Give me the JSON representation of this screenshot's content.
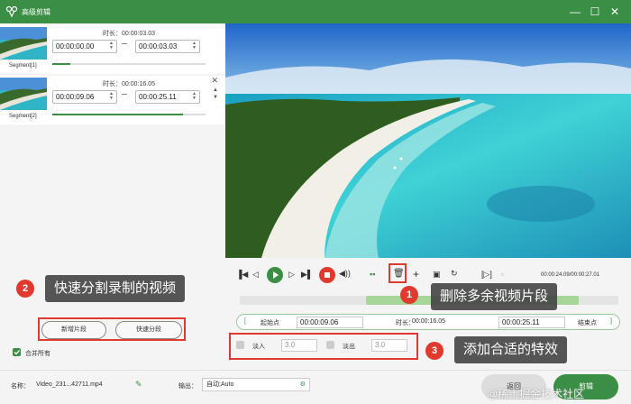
{
  "window": {
    "title": "高级剪辑"
  },
  "segments": [
    {
      "label": "Segment[1]",
      "duration": "时长：00:00:03.03",
      "start": "00:00:00.00",
      "end": "00:00:03.03",
      "progress": 0.12
    },
    {
      "label": "Segment[2]",
      "duration": "时长：00:00:16.05",
      "start": "00:00:09.06",
      "end": "00:00:25.11",
      "progress": 0.85
    }
  ],
  "left_buttons": {
    "new_segment": "新增片段",
    "quick_split": "快速分段"
  },
  "merge_all": "合并所有",
  "player": {
    "time": "00:00:24.09/00:00:27.01"
  },
  "range": {
    "start_label": "起始点",
    "start": "00:00:09.06",
    "duration_label": "时长：",
    "duration": "00:00:16.05",
    "end": "00:00:25.11",
    "end_label": "结束点"
  },
  "effects": {
    "fade_in_label": "淡入",
    "fade_in_value": "3.0",
    "fade_out_label": "淡出",
    "fade_out_value": "3.0"
  },
  "bottom": {
    "name_label": "名称：",
    "file_name": "Video_231...42711.mp4",
    "output_label": "输出：",
    "output_value": "自动;Auto",
    "back": "返回",
    "clip": "剪辑"
  },
  "callouts": [
    {
      "num": "1",
      "text": "删除多余视频片段"
    },
    {
      "num": "2",
      "text": "快速分割录制的视频"
    },
    {
      "num": "3",
      "text": "添加合适的特效"
    }
  ],
  "watermark": "@稀土掘金技术社区",
  "colors": {
    "accent": "#3a8f45",
    "callout_badge": "#e03a2e"
  }
}
